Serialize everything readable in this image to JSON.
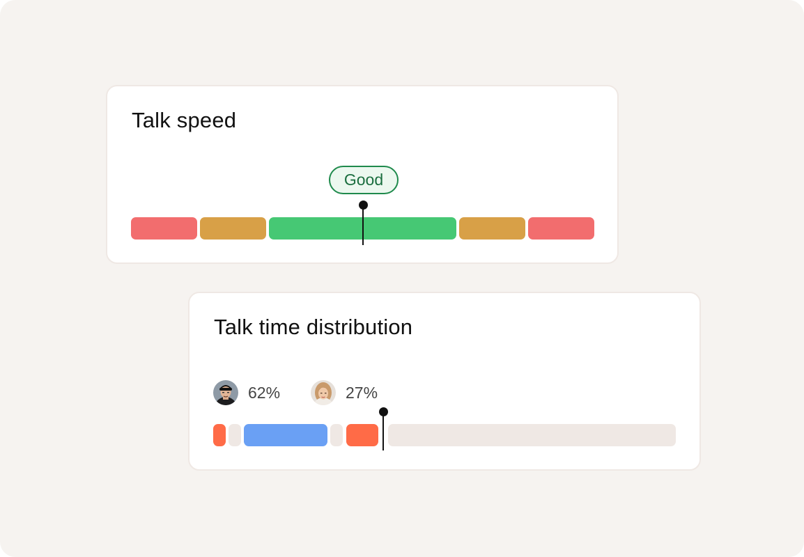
{
  "talk_speed": {
    "title": "Talk speed",
    "indicator_label": "Good",
    "scale_segments": [
      {
        "zone": "too-slow",
        "color": "#f26d6e"
      },
      {
        "zone": "slow",
        "color": "#d8a047"
      },
      {
        "zone": "good",
        "color": "#46c874"
      },
      {
        "zone": "fast",
        "color": "#d8a047"
      },
      {
        "zone": "too-fast",
        "color": "#f26d6e"
      }
    ]
  },
  "talk_time_distribution": {
    "title": "Talk time distribution",
    "speakers": [
      {
        "avatar_icon": "person-man-cap-icon",
        "percentage": "62%",
        "share": 0.62
      },
      {
        "avatar_icon": "person-woman-icon",
        "percentage": "27%",
        "share": 0.27
      }
    ],
    "timeline_segment_colors": [
      "#ff6b47",
      "#efe8e4",
      "#6aa0f4",
      "#efe8e4",
      "#ff6b47",
      "#efe8e4"
    ]
  },
  "colors": {
    "background": "#f6f3f0",
    "card": "#ffffff",
    "good_badge_border": "#1f8a4c",
    "good_badge_text": "#1b6e3f"
  }
}
